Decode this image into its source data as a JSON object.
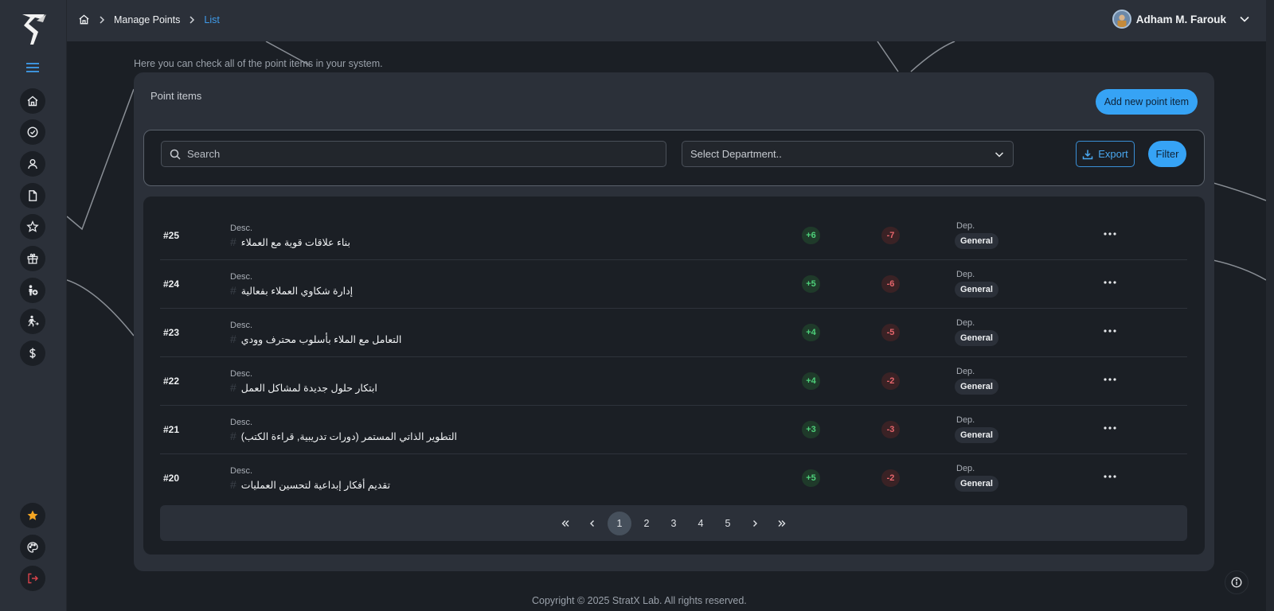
{
  "topbar": {
    "breadcrumb": [
      {
        "label": "Manage Points"
      },
      {
        "label": "List"
      }
    ],
    "user_name": "Adham M. Farouk"
  },
  "sidebar": {
    "items": [
      {
        "icon": "home-icon"
      },
      {
        "icon": "check-circle-icon"
      },
      {
        "icon": "user-icon"
      },
      {
        "icon": "document-icon"
      },
      {
        "icon": "star-icon"
      },
      {
        "icon": "gift-icon"
      },
      {
        "icon": "person-add-icon"
      },
      {
        "icon": "running-person-icon"
      },
      {
        "icon": "dollar-icon"
      }
    ],
    "bottom": [
      {
        "icon": "star-filled-icon"
      },
      {
        "icon": "palette-icon"
      },
      {
        "icon": "logout-icon"
      }
    ]
  },
  "page": {
    "intro": "Here you can check all of the point items in your system.",
    "card_title": "Point items",
    "add_button": "Add new point item",
    "search_placeholder": "Search",
    "department_placeholder": "Select Department..",
    "export_label": "Export",
    "filter_label": "Filter"
  },
  "table": {
    "desc_label": "Desc.",
    "dep_label": "Dep.",
    "rows": [
      {
        "id": "#25",
        "desc": "بناء علاقات قوية مع العملاء",
        "plus": "+6",
        "minus": "-7",
        "dep": "General"
      },
      {
        "id": "#24",
        "desc": "إدارة شكاوي العملاء بفعالية",
        "plus": "+5",
        "minus": "-6",
        "dep": "General"
      },
      {
        "id": "#23",
        "desc": "التعامل مع الملاء بأسلوب محترف وودي",
        "plus": "+4",
        "minus": "-5",
        "dep": "General"
      },
      {
        "id": "#22",
        "desc": "ابتكار حلول جديدة لمشاكل العمل",
        "plus": "+4",
        "minus": "-2",
        "dep": "General"
      },
      {
        "id": "#21",
        "desc": "التطوير الذاتي المستمر (دورات تدريبية, قراءة الكتب)",
        "plus": "+3",
        "minus": "-3",
        "dep": "General"
      },
      {
        "id": "#20",
        "desc": "تقديم أفكار إبداعية لتحسين العمليات",
        "plus": "+5",
        "minus": "-2",
        "dep": "General"
      }
    ]
  },
  "pagination": {
    "first": "«",
    "prev": "‹",
    "pages": [
      "1",
      "2",
      "3",
      "4",
      "5"
    ],
    "current": "1",
    "next": "›",
    "last": "»"
  },
  "footer": "Copyright © 2025 StratX Lab. All rights reserved.",
  "colors": {
    "accent": "#36a3f5",
    "positive": "#4ed07a",
    "negative": "#e5656b",
    "breadcrumb_active": "#3f9bea"
  }
}
